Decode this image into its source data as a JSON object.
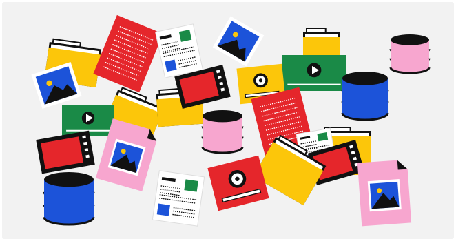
{
  "illustration": {
    "type": "scattered file icons",
    "icons": [
      "folder-icon",
      "image-file-icon",
      "text-document-icon",
      "layout-document-icon",
      "video-file-icon",
      "video-player-icon",
      "video-filmstrip-icon",
      "audio-file-icon",
      "database-icon"
    ]
  },
  "colors": {
    "background": "#f2f2f2",
    "black": "#111111",
    "red": "#e5262b",
    "yellow": "#fcc60a",
    "green": "#1a8a47",
    "blue": "#1c53d9",
    "pink": "#f7a6cf",
    "white": "#ffffff"
  }
}
